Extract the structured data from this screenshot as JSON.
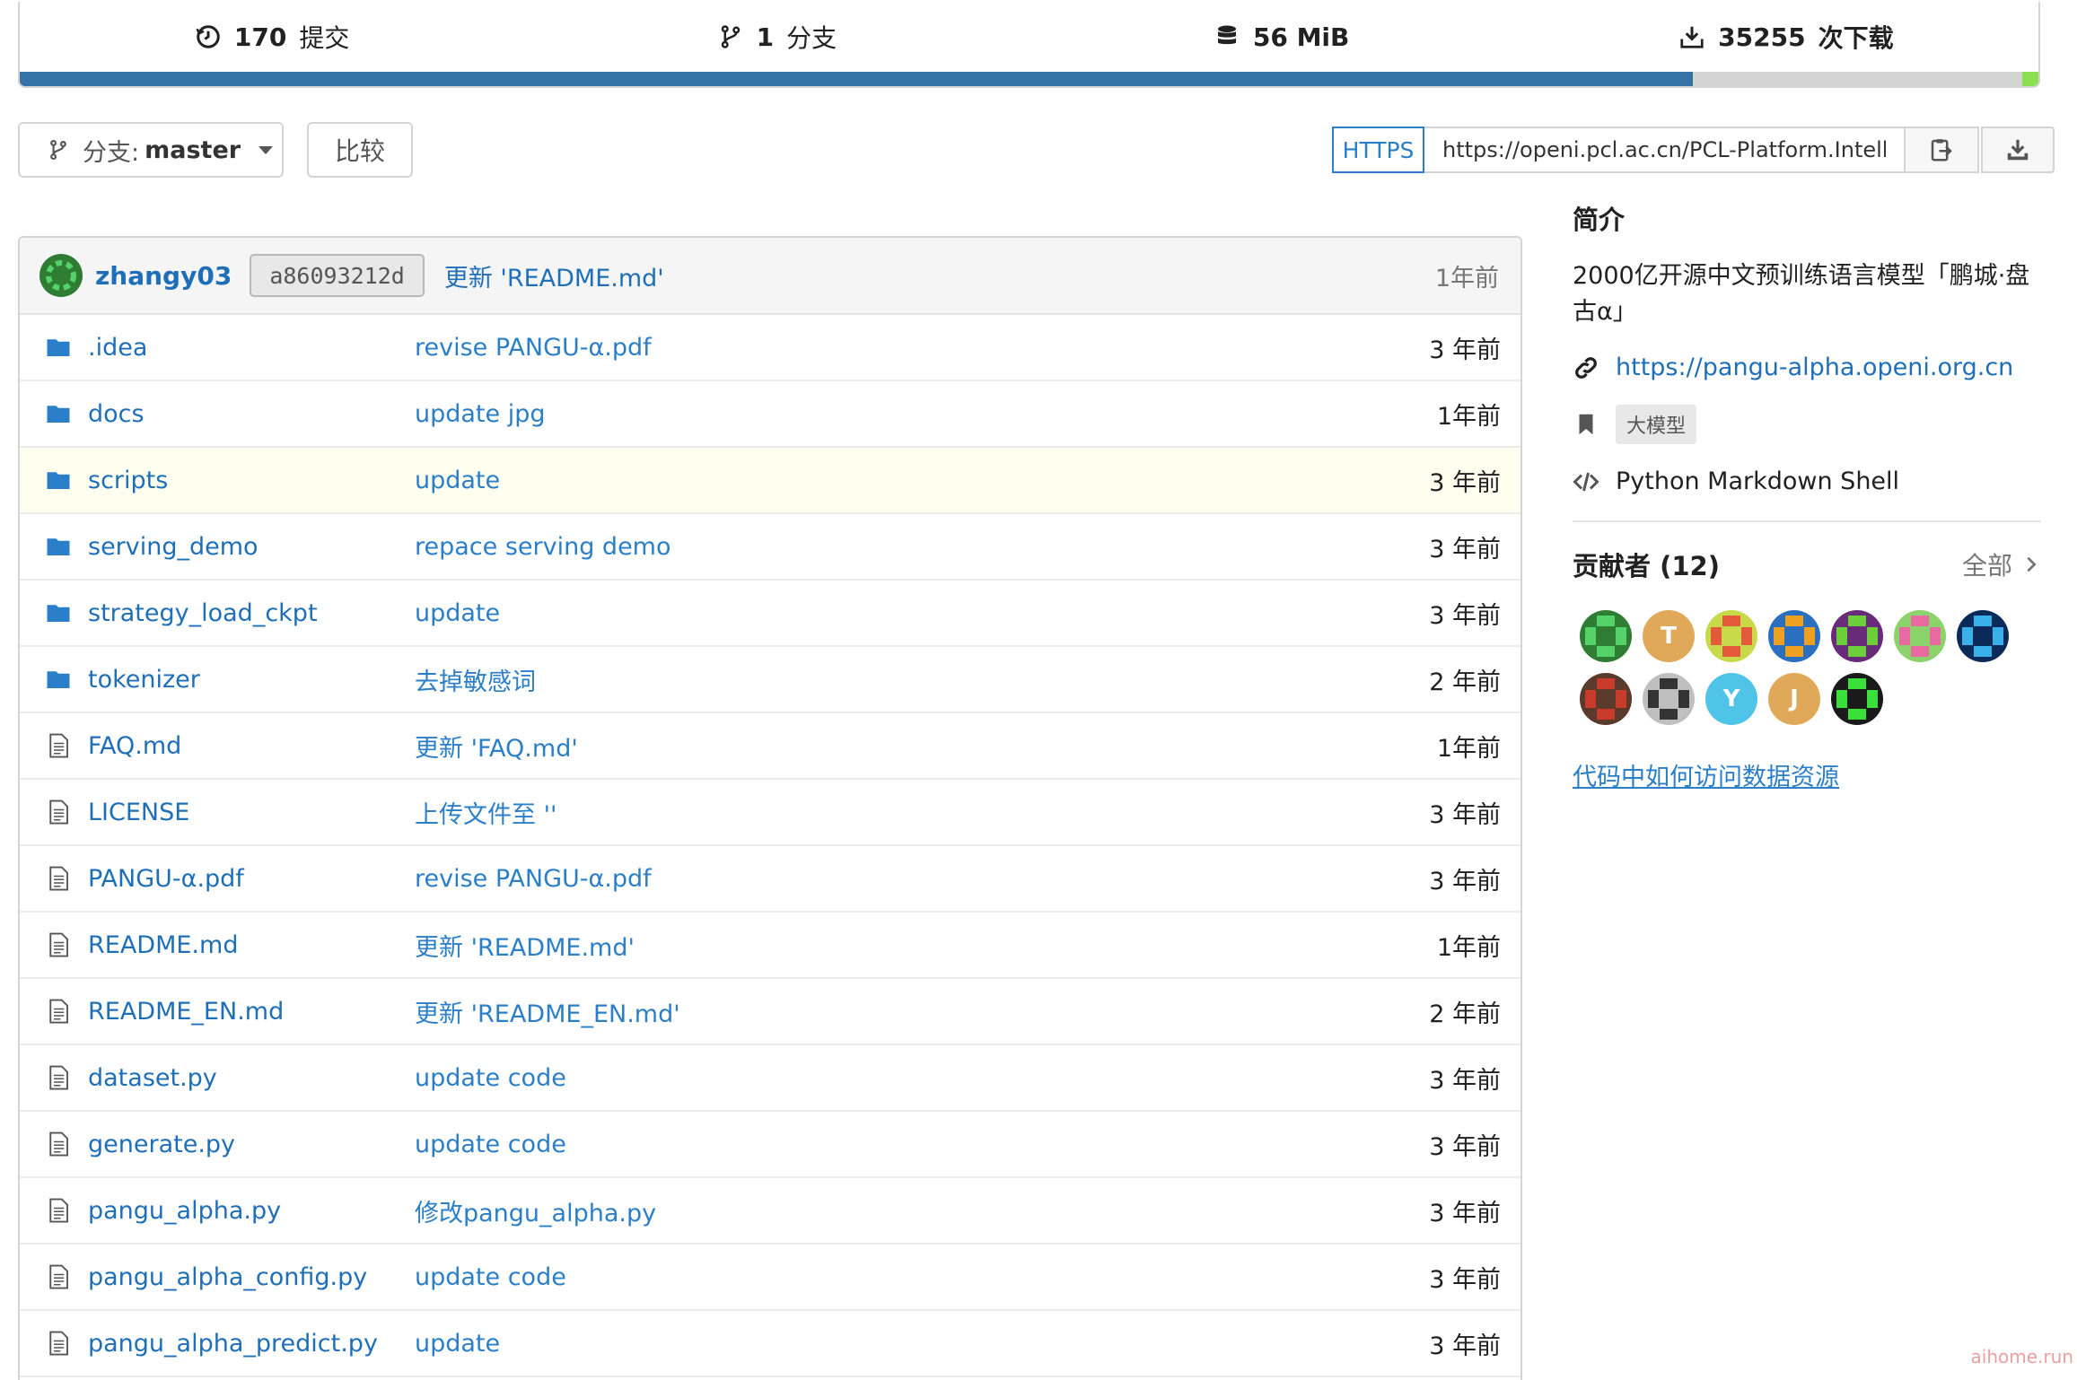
{
  "stats": {
    "commits": {
      "count": "170",
      "label": "提交"
    },
    "branches": {
      "count": "1",
      "label": "分支"
    },
    "size": {
      "value": "56 MiB"
    },
    "downloads": {
      "count": "35255",
      "label": "次下载"
    }
  },
  "language_bar": [
    {
      "color": "#3572A5",
      "fraction": 0.829
    },
    {
      "color": "#d4d4d4",
      "fraction": 0.163
    },
    {
      "color": "#89e051",
      "fraction": 0.008
    }
  ],
  "toolbar": {
    "branch_prefix": "分支:",
    "branch_name": "master",
    "compare_label": "比较",
    "clone_protocol": "HTTPS",
    "clone_url": "https://openi.pcl.ac.cn/PCL-Platform.Intelligence/PanGu-Alpha.git"
  },
  "latest_commit": {
    "user": "zhangy03",
    "sha": "a86093212d",
    "message": "更新 'README.md'",
    "time": "1年前"
  },
  "files": [
    {
      "name": ".idea",
      "type": "dir",
      "message": "revise PANGU-α.pdf",
      "time": "3 年前"
    },
    {
      "name": "docs",
      "type": "dir",
      "message": "update jpg",
      "time": "1年前"
    },
    {
      "name": "scripts",
      "type": "dir",
      "message": "update",
      "time": "3 年前"
    },
    {
      "name": "serving_demo",
      "type": "dir",
      "message": "repace serving demo",
      "time": "3 年前"
    },
    {
      "name": "strategy_load_ckpt",
      "type": "dir",
      "message": "update",
      "time": "3 年前"
    },
    {
      "name": "tokenizer",
      "type": "dir",
      "message": "去掉敏感词",
      "time": "2 年前"
    },
    {
      "name": "FAQ.md",
      "type": "file",
      "message": "更新 'FAQ.md'",
      "time": "1年前"
    },
    {
      "name": "LICENSE",
      "type": "file",
      "message": "上传文件至 ''",
      "time": "3 年前"
    },
    {
      "name": "PANGU-α.pdf",
      "type": "file",
      "message": "revise PANGU-α.pdf",
      "time": "3 年前"
    },
    {
      "name": "README.md",
      "type": "file",
      "message": "更新 'README.md'",
      "time": "1年前"
    },
    {
      "name": "README_EN.md",
      "type": "file",
      "message": "更新 'README_EN.md'",
      "time": "2 年前"
    },
    {
      "name": "dataset.py",
      "type": "file",
      "message": "update code",
      "time": "3 年前"
    },
    {
      "name": "generate.py",
      "type": "file",
      "message": "update code",
      "time": "3 年前"
    },
    {
      "name": "pangu_alpha.py",
      "type": "file",
      "message": "修改pangu_alpha.py",
      "time": "3 年前"
    },
    {
      "name": "pangu_alpha_config.py",
      "type": "file",
      "message": "update code",
      "time": "3 年前"
    },
    {
      "name": "pangu_alpha_predict.py",
      "type": "file",
      "message": "update",
      "time": "3 年前"
    }
  ],
  "sidebar": {
    "about_title": "简介",
    "description": "2000亿开源中文预训练语言模型「鹏城·盘古α」",
    "website": "https://pangu-alpha.openi.org.cn",
    "topic": "大模型",
    "languages": "Python Markdown Shell",
    "contributors_title": "贡献者 (12)",
    "all_label": "全部",
    "contributors": [
      {
        "initial": "",
        "color": "#2e7d32",
        "accent": "#55d36a"
      },
      {
        "initial": "T",
        "color": "#e0a95a",
        "accent": ""
      },
      {
        "initial": "",
        "color": "#c8d94a",
        "accent": "#e35b3b"
      },
      {
        "initial": "",
        "color": "#2a6fc0",
        "accent": "#f0a020"
      },
      {
        "initial": "",
        "color": "#6a2a7a",
        "accent": "#6bcf3a"
      },
      {
        "initial": "",
        "color": "#8bd36a",
        "accent": "#e86aa0"
      },
      {
        "initial": "",
        "color": "#0a2a5a",
        "accent": "#3ab0e8"
      },
      {
        "initial": "",
        "color": "#5a3a2a",
        "accent": "#c83a2a"
      },
      {
        "initial": "",
        "color": "#bfbfbf",
        "accent": "#333333"
      },
      {
        "initial": "Y",
        "color": "#4fc3e8",
        "accent": ""
      },
      {
        "initial": "J",
        "color": "#e0a95a",
        "accent": ""
      },
      {
        "initial": "",
        "color": "#1a1a1a",
        "accent": "#3adf3a"
      }
    ],
    "help_link": "代码中如何访问数据资源"
  },
  "watermark": "aihome.run"
}
